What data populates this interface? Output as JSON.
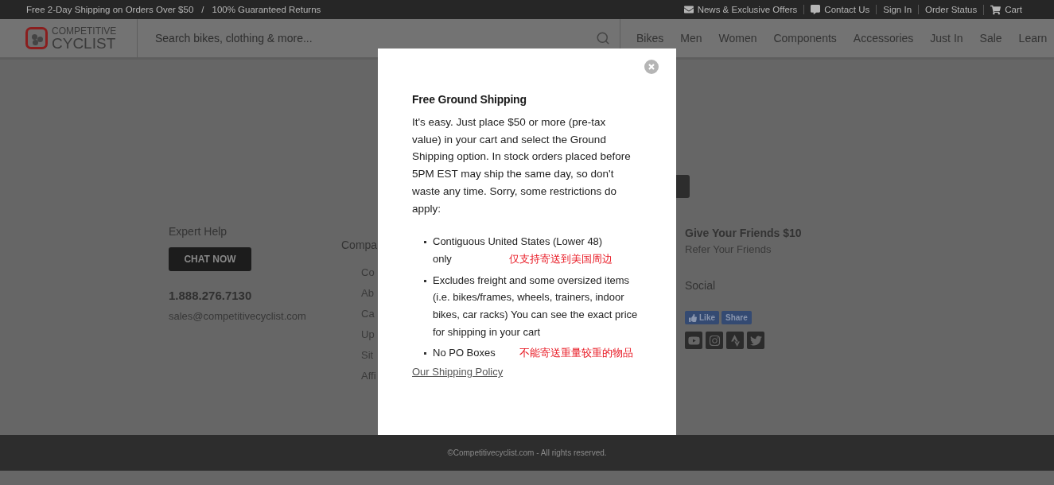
{
  "top_bar": {
    "promos": [
      "Free 2-Day Shipping on Orders Over $50",
      "100% Guaranteed Returns"
    ],
    "separator": "/",
    "links": [
      {
        "kind": "mail",
        "label": "News & Exclusive Offers"
      },
      {
        "kind": "chat",
        "label": "Contact Us"
      },
      {
        "kind": "plain",
        "label": "Sign In"
      },
      {
        "kind": "plain",
        "label": "Order Status"
      },
      {
        "kind": "cart",
        "label": "Cart"
      }
    ]
  },
  "header": {
    "logo": {
      "line_1": "COMPETITIVE",
      "line_2": "CYCLIST"
    },
    "search": {
      "placeholder": "Search bikes, clothing & more..."
    },
    "nav": [
      "Bikes",
      "Men",
      "Women",
      "Components",
      "Accessories",
      "Just In",
      "Sale",
      "Learn"
    ]
  },
  "footer": {
    "expert_help": {
      "heading": "Expert Help",
      "chat_button": "CHAT NOW",
      "phone": "1.888.276.7130",
      "email": "sales@competitivecyclist.com"
    },
    "company": {
      "heading": "Compa",
      "links": [
        "Co",
        "Ab",
        "Ca",
        "Up",
        "Sit",
        "Affi"
      ]
    },
    "referral": {
      "heading": "Give Your Friends $10",
      "link": "Refer Your Friends"
    },
    "social": {
      "heading": "Social",
      "like": "Like",
      "share": "Share"
    },
    "copyright": "©Competitivecyclist.com - All rights reserved."
  },
  "modal": {
    "title": "Free Ground Shipping",
    "body": "It's easy. Just place $50 or more (pre-tax value) in your cart and select the Ground Shipping option. In stock orders placed before 5PM EST may ship the same day, so don't waste any time. Sorry, some restrictions do apply:",
    "items": [
      {
        "text": "Contiguous United States (Lower 48)",
        "continuation": "only",
        "annotation": "仅支持寄送到美国周边"
      },
      {
        "text": "Excludes freight and some oversized items (i.e. bikes/frames, wheels, trainers, indoor bikes, car racks) You can see the exact price for shipping in your cart"
      },
      {
        "text": "No PO Boxes",
        "annotation": "不能寄送重量较重的物品"
      }
    ],
    "link": "Our Shipping Policy"
  }
}
